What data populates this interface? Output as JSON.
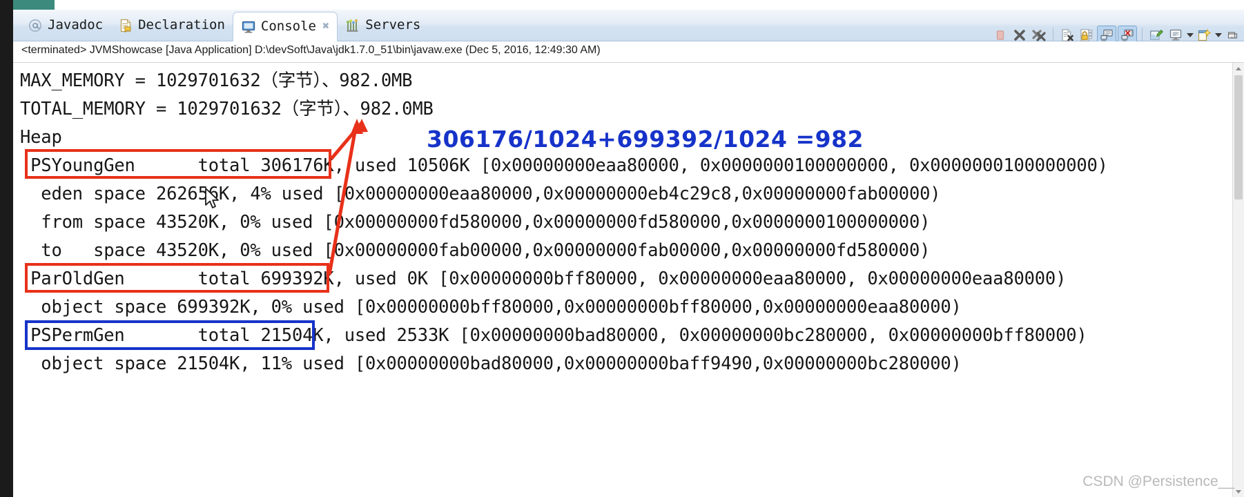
{
  "tabs": [
    {
      "label": "Javadoc",
      "icon": "at-sign-icon",
      "active": false,
      "closable": false
    },
    {
      "label": "Declaration",
      "icon": "declaration-icon",
      "active": false,
      "closable": false
    },
    {
      "label": "Console",
      "icon": "console-monitor-icon",
      "active": true,
      "closable": true,
      "close_glyph": "✖"
    },
    {
      "label": "Servers",
      "icon": "servers-icon",
      "active": false,
      "closable": false
    }
  ],
  "toolbar": {
    "buttons": [
      {
        "name": "terminate-button",
        "title": "Terminate"
      },
      {
        "name": "remove-launch-button",
        "title": "Remove Launch"
      },
      {
        "name": "remove-all-terminated-button",
        "title": "Remove All Terminated Launches"
      },
      {
        "name": "clear-console-button",
        "title": "Clear Console"
      },
      {
        "name": "scroll-lock-button",
        "title": "Scroll Lock"
      },
      {
        "name": "show-console-on-output-button",
        "title": "Show Console When Standard Out Changes"
      },
      {
        "name": "show-console-on-error-button",
        "title": "Show Console When Standard Error Changes"
      },
      {
        "name": "pin-console-button",
        "title": "Pin Console"
      },
      {
        "name": "display-selected-console-button",
        "title": "Display Selected Console"
      },
      {
        "name": "open-console-button",
        "title": "Open Console"
      },
      {
        "name": "minimize-button",
        "title": "Minimize"
      },
      {
        "name": "maximize-button",
        "title": "Maximize"
      }
    ]
  },
  "launch": {
    "status": "<terminated>",
    "config": "JVMShowcase",
    "type": "[Java Application]",
    "path": "D:\\devSoft\\Java\\jdk1.7.0_51\\bin\\javaw.exe",
    "timestamp": "(Dec 5, 2016, 12:49:30 AM)",
    "full_line": "<terminated> JVMShowcase [Java Application] D:\\devSoft\\Java\\jdk1.7.0_51\\bin\\javaw.exe (Dec 5, 2016, 12:49:30 AM)"
  },
  "console": {
    "lines": [
      "MAX_MEMORY = 1029701632（字节）、982.0MB",
      "TOTAL_MEMORY = 1029701632（字节）、982.0MB",
      "Heap",
      " PSYoungGen      total 306176K, used 10506K [0x00000000eaa80000, 0x0000000100000000, 0x0000000100000000)",
      "  eden space 262656K, 4% used [0x00000000eaa80000,0x00000000eb4c29c8,0x00000000fab00000)",
      "  from space 43520K, 0% used [0x00000000fd580000,0x00000000fd580000,0x0000000100000000)",
      "  to   space 43520K, 0% used [0x00000000fab00000,0x00000000fab00000,0x00000000fd580000)",
      " ParOldGen       total 699392K, used 0K [0x00000000bff80000, 0x00000000eaa80000, 0x00000000eaa80000)",
      "  object space 699392K, 0% used [0x00000000bff80000,0x00000000bff80000,0x00000000eaa80000)",
      " PSPermGen       total 21504K, used 2533K [0x00000000bad80000, 0x00000000bc280000, 0x00000000bff80000)",
      "  object space 21504K, 11% used [0x00000000bad80000,0x00000000baff9490,0x00000000bc280000)"
    ]
  },
  "annotations": {
    "formula": "306176/1024+699392/1024 =982",
    "formula_color": "#1633c9",
    "highlight_color_red": "#e8311a",
    "highlight_color_blue": "#1633c9",
    "boxes": [
      {
        "name": "psyounggen-total-highlight",
        "label": "PSYoungGen      total 306176K",
        "color": "#e8311a"
      },
      {
        "name": "paroldgen-total-highlight",
        "label": "ParOldGen       total 699392K",
        "color": "#e8311a"
      },
      {
        "name": "pspermgen-total-highlight",
        "label": "PSPermGen       total 21504K",
        "color": "#1633c9"
      }
    ],
    "arrow_targets": "982.0MB"
  },
  "watermark": "CSDN @Persistence__"
}
